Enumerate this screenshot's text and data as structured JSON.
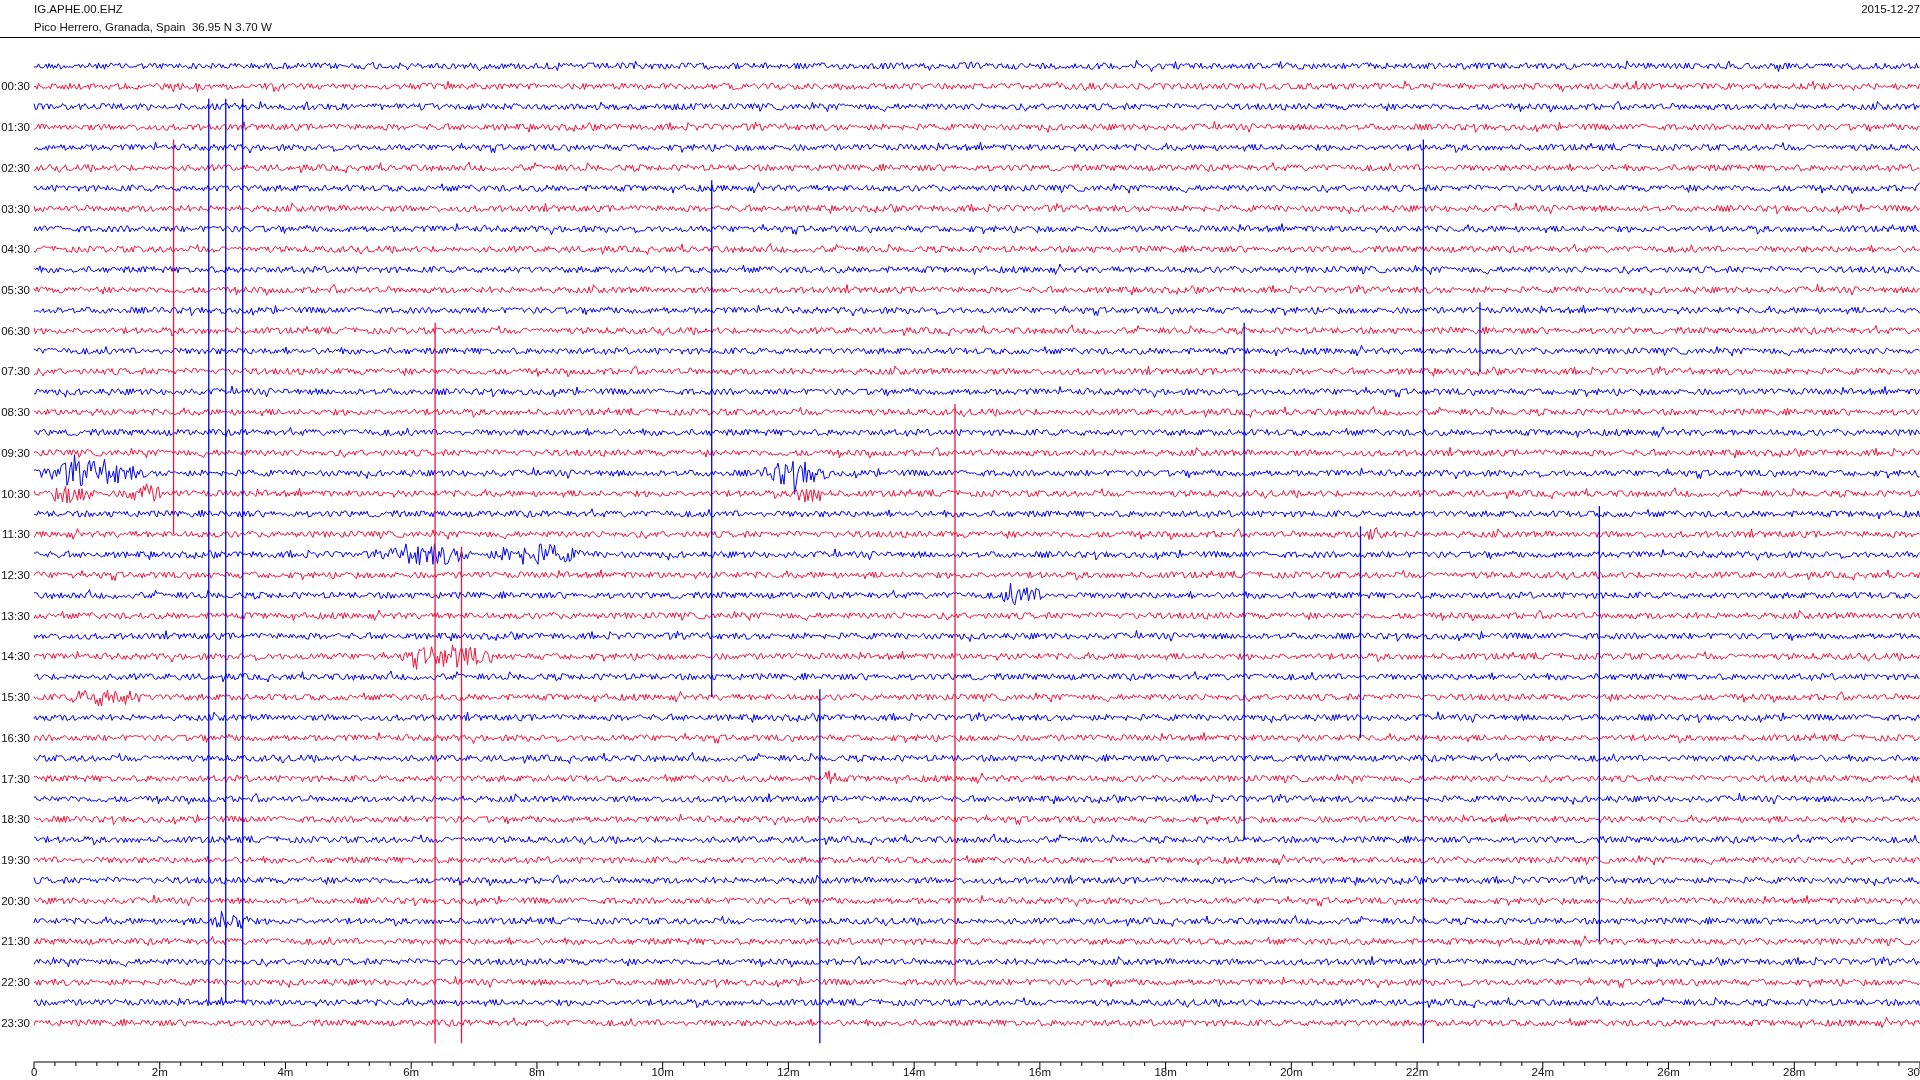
{
  "header": {
    "station": "IG.APHE.00.EHZ",
    "location": "Pico Herrero, Granada, Spain  36.95 N 3.70 W",
    "date": "2015-12-27"
  },
  "helicorder": {
    "row_labels": [
      "00:30",
      "01:30",
      "02:30",
      "03:30",
      "04:30",
      "05:30",
      "06:30",
      "07:30",
      "08:30",
      "09:30",
      "10:30",
      "11:30",
      "12:30",
      "13:30",
      "14:30",
      "15:30",
      "16:30",
      "17:30",
      "18:30",
      "19:30",
      "20:30",
      "21:30",
      "22:30",
      "23:30"
    ],
    "x_tick_labels": [
      "0",
      "2m",
      "4m",
      "6m",
      "8m",
      "10m",
      "12m",
      "14m",
      "16m",
      "18m",
      "20m",
      "22m",
      "24m",
      "26m",
      "28m",
      "30"
    ]
  }
}
